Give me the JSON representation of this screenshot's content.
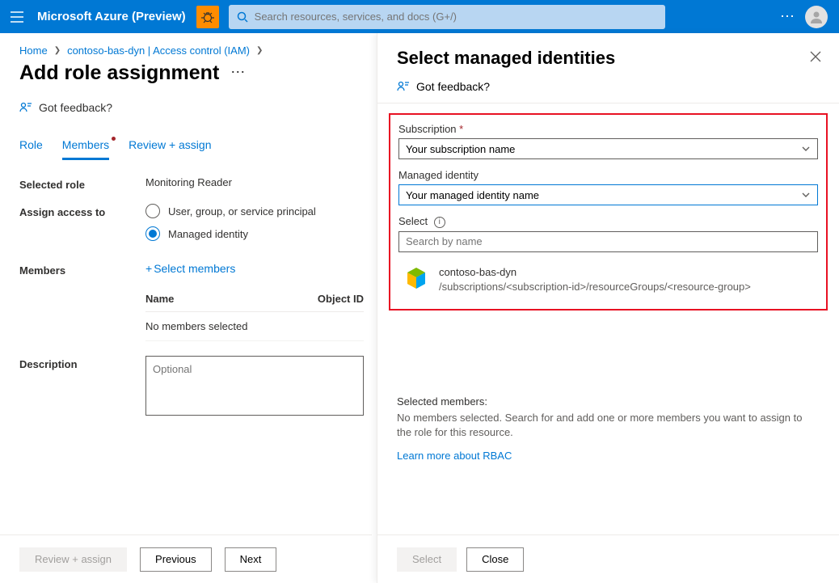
{
  "header": {
    "brand": "Microsoft Azure (Preview)",
    "search_placeholder": "Search resources, services, and docs (G+/)"
  },
  "breadcrumb": {
    "home": "Home",
    "path": "contoso-bas-dyn | Access control (IAM)"
  },
  "page": {
    "title": "Add role assignment",
    "feedback": "Got feedback?"
  },
  "tabs": {
    "role": "Role",
    "members": "Members",
    "review": "Review + assign"
  },
  "form": {
    "selected_role_label": "Selected role",
    "selected_role_value": "Monitoring Reader",
    "assign_access_label": "Assign access to",
    "radio_user": "User, group, or service principal",
    "radio_managed": "Managed identity",
    "members_label": "Members",
    "select_members": "Select members",
    "col_name": "Name",
    "col_objectid": "Object ID",
    "empty_row": "No members selected",
    "description_label": "Description",
    "description_placeholder": "Optional"
  },
  "footer": {
    "review": "Review + assign",
    "previous": "Previous",
    "next": "Next"
  },
  "panel": {
    "title": "Select managed identities",
    "feedback": "Got feedback?",
    "subscription_label": "Subscription",
    "subscription_value": "Your subscription name",
    "managed_label": "Managed identity",
    "managed_value": "Your managed identity name",
    "select_label": "Select",
    "search_placeholder": "Search by name",
    "result_name": "contoso-bas-dyn",
    "result_path": "/subscriptions/<subscription-id>/resourceGroups/<resource-group>",
    "selected_title": "Selected members:",
    "selected_text": "No members selected. Search for and add one or more members you want to assign to the role for this resource.",
    "learn_more": "Learn more about RBAC",
    "btn_select": "Select",
    "btn_close": "Close"
  }
}
